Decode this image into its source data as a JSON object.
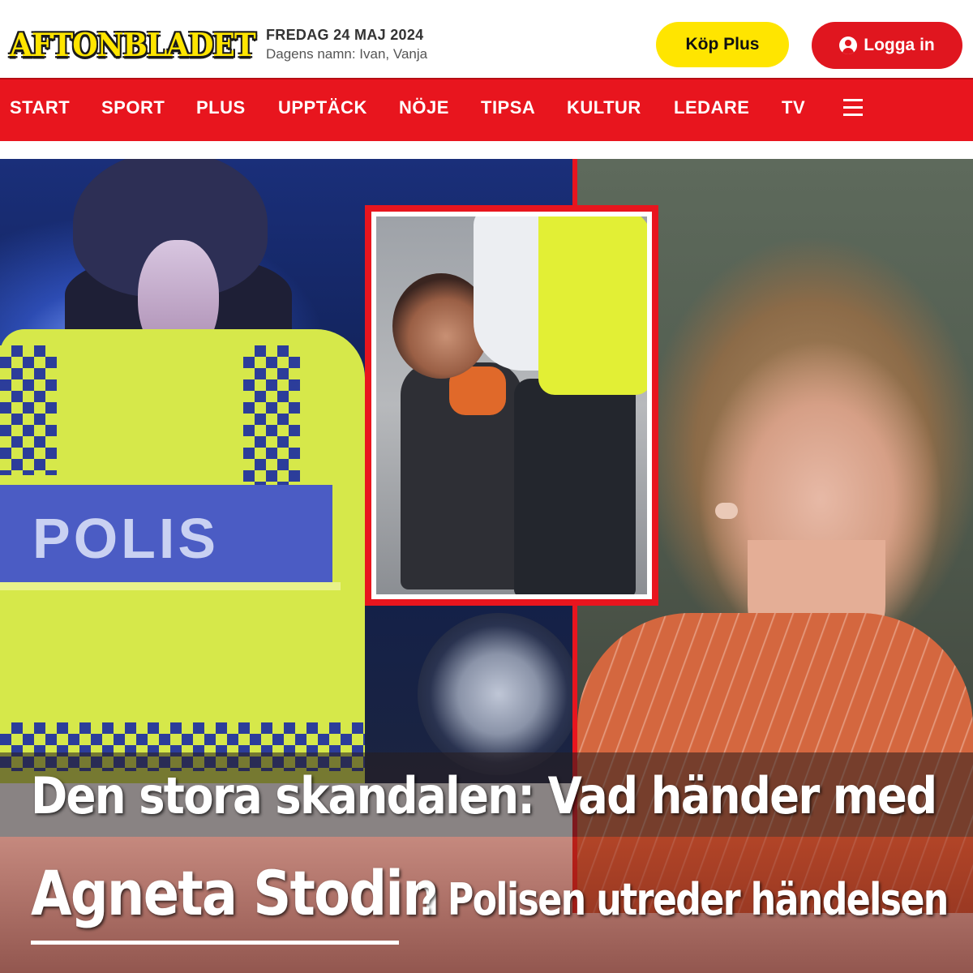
{
  "header": {
    "logo": "AFTONBLADET",
    "date": "FREDAG 24 MAJ 2024",
    "namnsdag": "Dagens namn: Ivan, Vanja",
    "plus_button": "Köp Plus",
    "login_button": "Logga in"
  },
  "nav": {
    "items": [
      "START",
      "SPORT",
      "PLUS",
      "UPPTÄCK",
      "NÖJE",
      "TIPSA",
      "KULTUR",
      "LEDARE",
      "TV"
    ]
  },
  "images": {
    "left_vest_text": "POLIS"
  },
  "icons": {
    "login": "user-icon",
    "menu": "hamburger-icon"
  },
  "caption": {
    "line1": "Den stora skandalen: Vad händer med",
    "name": "Agneta Stodin",
    "line2": "? Polisen utreder händelsen"
  },
  "colors": {
    "brand_red": "#e8151e",
    "brand_yellow": "#ffe500"
  }
}
